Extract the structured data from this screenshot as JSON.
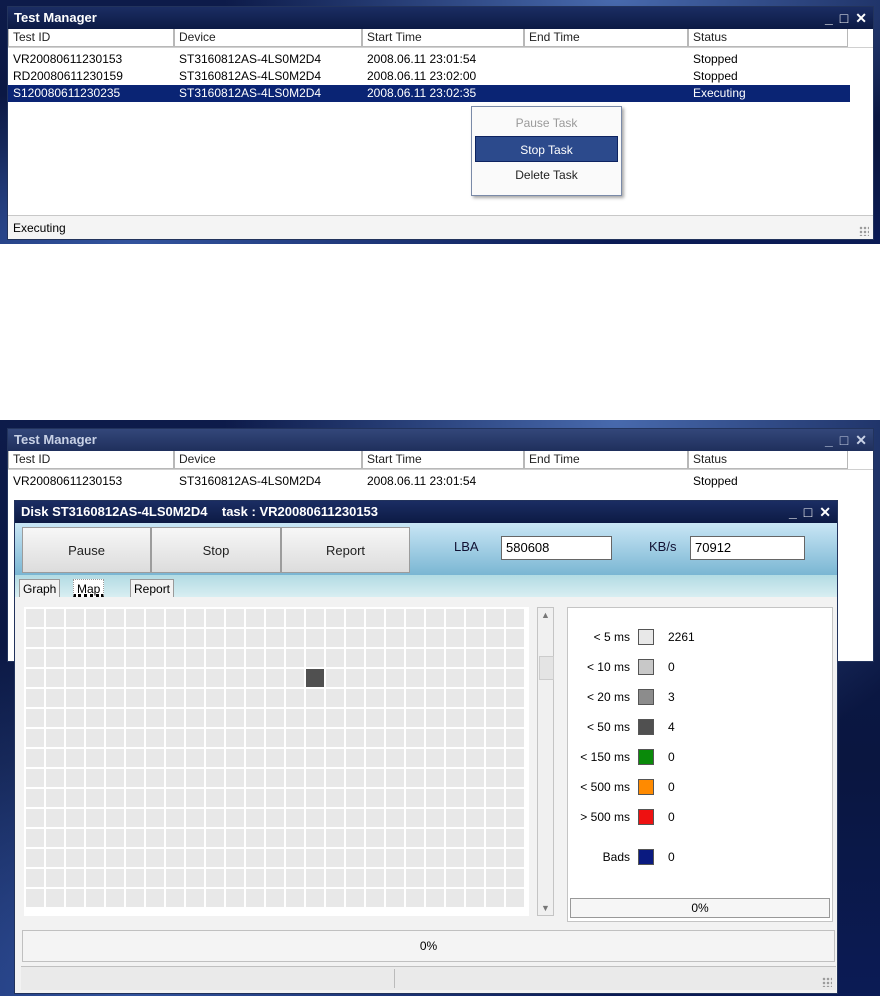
{
  "top_window": {
    "title": "Test Manager",
    "controls": {
      "minimize": "_",
      "maximize": "□",
      "close": "✕"
    },
    "columns": [
      "Test ID",
      "Device",
      "Start Time",
      "End Time",
      "Status"
    ],
    "rows": [
      {
        "id": "VR20080611230153",
        "device": "ST3160812AS-4LS0M2D4",
        "start": "2008.06.11 23:01:54",
        "end": "",
        "status": "Stopped"
      },
      {
        "id": "RD20080611230159",
        "device": "ST3160812AS-4LS0M2D4",
        "start": "2008.06.11 23:02:00",
        "end": "",
        "status": "Stopped"
      },
      {
        "id": "S120080611230235",
        "device": "ST3160812AS-4LS0M2D4",
        "start": "2008.06.11 23:02:35",
        "end": "",
        "status": "Executing"
      }
    ],
    "status_text": "Executing"
  },
  "context_menu": {
    "items": [
      {
        "label": "Pause Task",
        "state": "disabled"
      },
      {
        "label": "Stop Task",
        "state": "highlighted"
      },
      {
        "label": "Delete Task",
        "state": "normal"
      }
    ]
  },
  "bottom_window": {
    "title": "Test Manager",
    "controls": {
      "minimize": "_",
      "maximize": "□",
      "close": "✕"
    },
    "columns": [
      "Test ID",
      "Device",
      "Start Time",
      "End Time",
      "Status"
    ],
    "row": {
      "id": "VR20080611230153",
      "device": "ST3160812AS-4LS0M2D4",
      "start": "2008.06.11 23:01:54",
      "end": "",
      "status": "Stopped"
    }
  },
  "disk_window": {
    "title": "Disk ST3160812AS-4LS0M2D4    task : VR20080611230153",
    "controls": {
      "minimize": "_",
      "maximize": "□",
      "close": "✕"
    },
    "buttons": {
      "pause": "Pause",
      "stop": "Stop",
      "report": "Report"
    },
    "lba_label": "LBA",
    "lba_value": "580608",
    "kbs_label": "KB/s",
    "kbs_value": "70912",
    "tabs": [
      "Graph",
      "Map",
      "Report"
    ],
    "active_tab": "Map",
    "legend": [
      {
        "label": "< 5 ms",
        "color": "#e8e8e8",
        "count": "2261"
      },
      {
        "label": "< 10 ms",
        "color": "#c8c8c8",
        "count": "0"
      },
      {
        "label": "< 20 ms",
        "color": "#8c8c8c",
        "count": "3"
      },
      {
        "label": "< 50 ms",
        "color": "#505050",
        "count": "4"
      },
      {
        "label": "< 150 ms",
        "color": "#0a8a0a",
        "count": "0"
      },
      {
        "label": "< 500 ms",
        "color": "#ff8a00",
        "count": "0"
      },
      {
        "label": "> 500 ms",
        "color": "#ee1111",
        "count": "0"
      },
      {
        "label": "Bads",
        "color": "#0a1a80",
        "count": "0"
      }
    ],
    "legend_progress": "0%",
    "bottom_progress": "0%"
  }
}
